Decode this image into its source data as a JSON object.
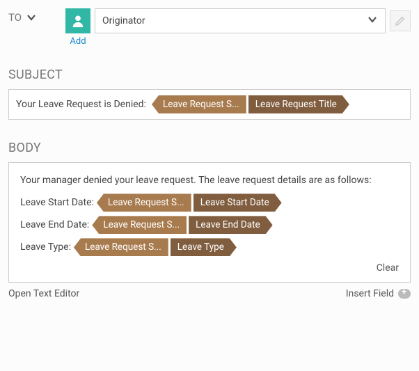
{
  "to": {
    "label": "TO",
    "add_label": "Add",
    "selected": "Originator"
  },
  "subject": {
    "label": "SUBJECT",
    "prefix": "Your Leave Request is Denied:",
    "tag_lead": "Leave Request S...",
    "tag_tail": "Leave Request Title"
  },
  "body": {
    "label": "BODY",
    "intro": "Your manager denied your leave request. The leave request details are as follows:",
    "lines": [
      {
        "label": "Leave Start Date:",
        "tag_lead": "Leave Request S...",
        "tag_tail": "Leave Start Date"
      },
      {
        "label": "Leave End Date:",
        "tag_lead": "Leave Request S...",
        "tag_tail": "Leave End Date"
      },
      {
        "label": "Leave Type:",
        "tag_lead": "Leave Request S...",
        "tag_tail": "Leave Type"
      }
    ],
    "clear": "Clear"
  },
  "footer": {
    "open_editor": "Open Text Editor",
    "insert_field": "Insert Field"
  }
}
